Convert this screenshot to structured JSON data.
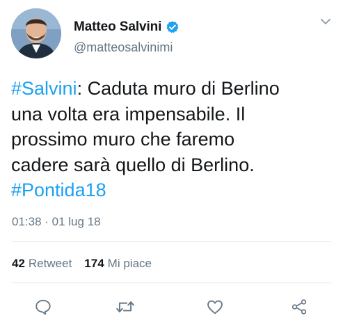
{
  "tweet": {
    "author": {
      "display_name": "Matteo Salvini",
      "handle": "@matteosalvinimi",
      "verified": true
    },
    "text": {
      "lines": [
        [
          {
            "t": "#Salvini",
            "hashtag": true
          },
          {
            "t": ": Caduta muro di Berlino",
            "hashtag": false
          }
        ],
        [
          {
            "t": "una volta era impensabile. Il",
            "hashtag": false
          }
        ],
        [
          {
            "t": "prossimo muro che faremo",
            "hashtag": false
          }
        ],
        [
          {
            "t": "cadere sarà quello di Berlino.",
            "hashtag": false
          }
        ],
        [
          {
            "t": "#Pontida18",
            "hashtag": true
          }
        ]
      ]
    },
    "timestamp": "01:38 · 01 lug 18",
    "stats": {
      "retweets_count": "42",
      "retweets_label": "Retweet",
      "likes_count": "174",
      "likes_label": "Mi piace"
    },
    "actions": {
      "reply_icon": "reply-icon",
      "retweet_icon": "retweet-icon",
      "like_icon": "heart-icon",
      "share_icon": "share-icon"
    },
    "colors": {
      "text": "#14171a",
      "secondary": "#657786",
      "link": "#1da1f2",
      "divider": "#e1e8ed"
    }
  }
}
